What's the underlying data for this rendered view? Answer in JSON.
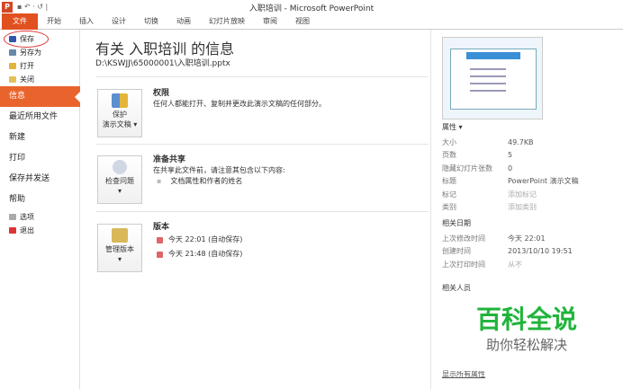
{
  "window": {
    "title": "入职培训 - Microsoft PowerPoint",
    "quick_access": "▪ ↶ · ↺ |"
  },
  "ribbon": {
    "tabs": [
      "文件",
      "开始",
      "插入",
      "设计",
      "切换",
      "动画",
      "幻灯片放映",
      "审阅",
      "视图"
    ]
  },
  "sidebar": {
    "small_top": [
      "保存",
      "另存为",
      "打开",
      "关闭"
    ],
    "big": [
      "信息",
      "最近所用文件",
      "新建",
      "打印",
      "保存并发送",
      "帮助"
    ],
    "small_bottom": [
      "选项",
      "退出"
    ]
  },
  "main": {
    "title": "有关 入职培训 的信息",
    "path": "D:\\KSWJJ\\65000001\\入职培训.pptx",
    "permissions": {
      "button": [
        "保护",
        "演示文稿 ▾"
      ],
      "title": "权限",
      "desc": "任何人都能打开、复制并更改此演示文稿的任何部分。"
    },
    "share": {
      "button": [
        "检查问题",
        "▾"
      ],
      "title": "准备共享",
      "desc": "在共享此文件前，请注意其包含以下内容:",
      "items": [
        "文档属性和作者的姓名"
      ]
    },
    "versions": {
      "button": [
        "管理版本",
        "▾"
      ],
      "title": "版本",
      "items": [
        "今天 22:01 (自动保存)",
        "今天 21:48 (自动保存)"
      ]
    }
  },
  "properties": {
    "header": "属性 ▾",
    "rows": [
      [
        "大小",
        "49.7KB"
      ],
      [
        "页数",
        "5"
      ],
      [
        "隐藏幻灯片张数",
        "0"
      ],
      [
        "标题",
        "PowerPoint 演示文稿"
      ],
      [
        "标记",
        "添加标记"
      ],
      [
        "类别",
        "添加类别"
      ]
    ],
    "dates_header": "相关日期",
    "dates": [
      [
        "上次修改时间",
        "今天 22:01"
      ],
      [
        "创建时间",
        "2013/10/10 19:51"
      ],
      [
        "上次打印时间",
        "从不"
      ]
    ],
    "people_header": "相关人员",
    "show_all": "显示所有属性"
  },
  "watermark": {
    "main": "百科全说",
    "sub": "助你轻松解决"
  }
}
